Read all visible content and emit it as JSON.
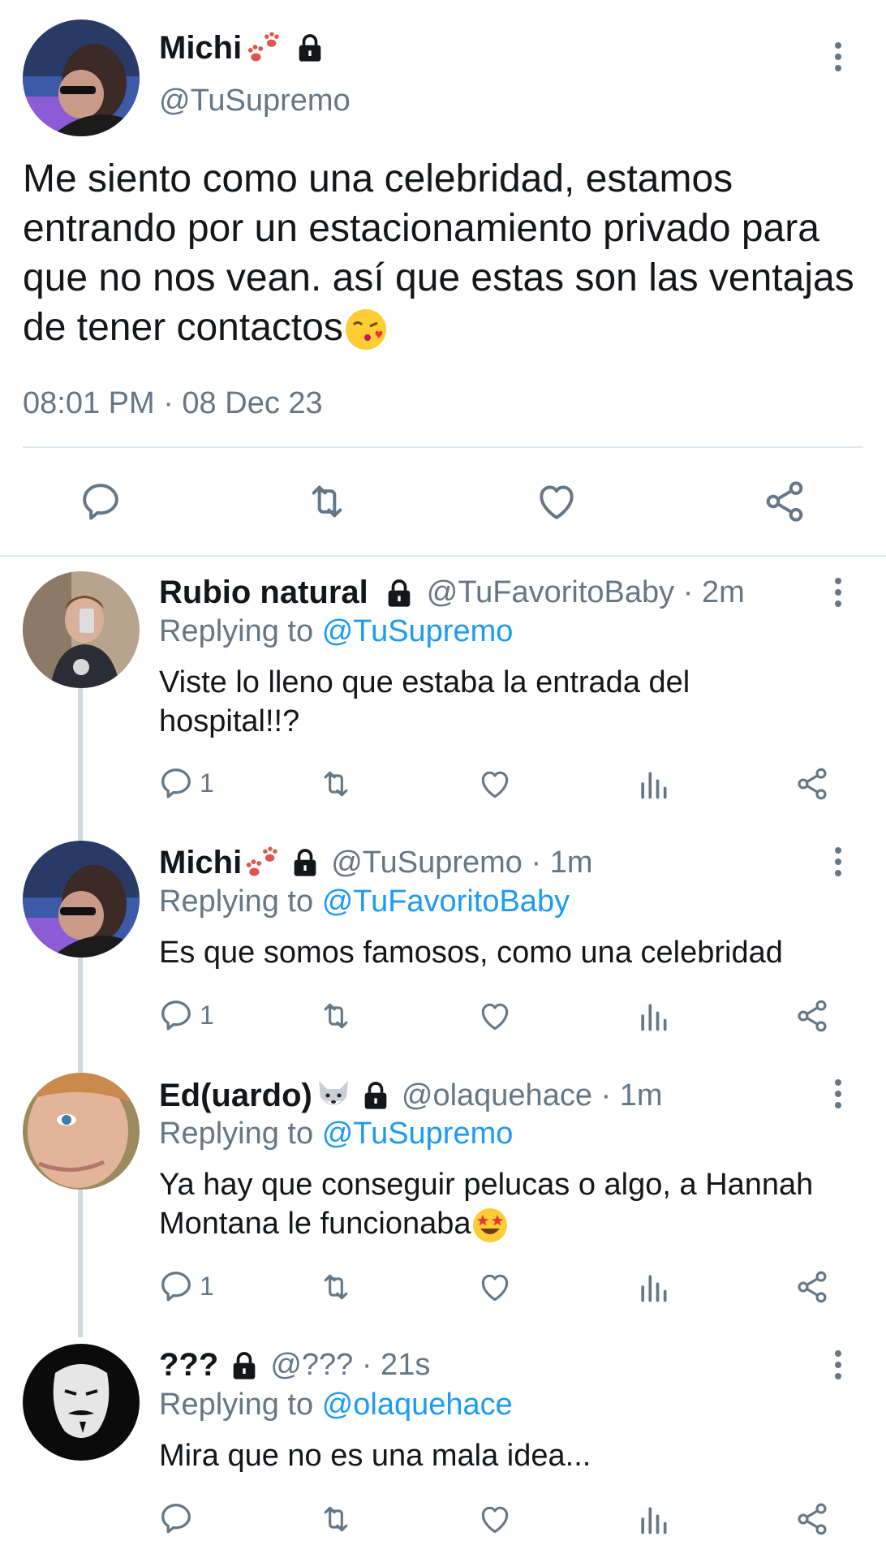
{
  "main_tweet": {
    "name": "Michi",
    "handle": "@TuSupremo",
    "text": "Me siento como una celebridad, estamos entrando por un estacionamiento privado para que no nos vean. así que estas son las ventajas de tener contactos",
    "timestamp": "08:01 PM · 08 Dec 23"
  },
  "replies": [
    {
      "name": "Rubio natural",
      "meta": "@TuFavoritoBaby · 2m",
      "replying_label": "Replying to",
      "replying_to": "@TuSupremo",
      "text": "Viste lo lleno que estaba la entrada del hospital!!?",
      "reply_count": "1"
    },
    {
      "name": "Michi",
      "meta": "@TuSupremo · 1m",
      "replying_label": "Replying to",
      "replying_to": "@TuFavoritoBaby",
      "text": "Es que somos famosos, como una celebridad",
      "reply_count": "1"
    },
    {
      "name": "Ed(uardo)",
      "meta": "@olaquehace · 1m",
      "replying_label": "Replying to",
      "replying_to": "@TuSupremo",
      "text": "Ya hay que conseguir pelucas o algo, a Hannah Montana le funcionaba",
      "reply_count": "1"
    },
    {
      "name": "???",
      "meta": "@??? · 21s",
      "replying_label": "Replying to",
      "replying_to": "@olaquehace",
      "text": "Mira que no es una mala idea...",
      "reply_count": ""
    }
  ],
  "icons": [
    "reply-icon",
    "retweet-icon",
    "like-icon",
    "share-icon",
    "analytics-icon",
    "lock-icon",
    "more-icon",
    "paw-emoji",
    "kiss-emoji",
    "wolf-emoji",
    "star-eyes-emoji"
  ],
  "colors": {
    "accent": "#1d9bf0",
    "muted": "#657786",
    "text": "#14171a",
    "divider": "#e1e8ed"
  }
}
